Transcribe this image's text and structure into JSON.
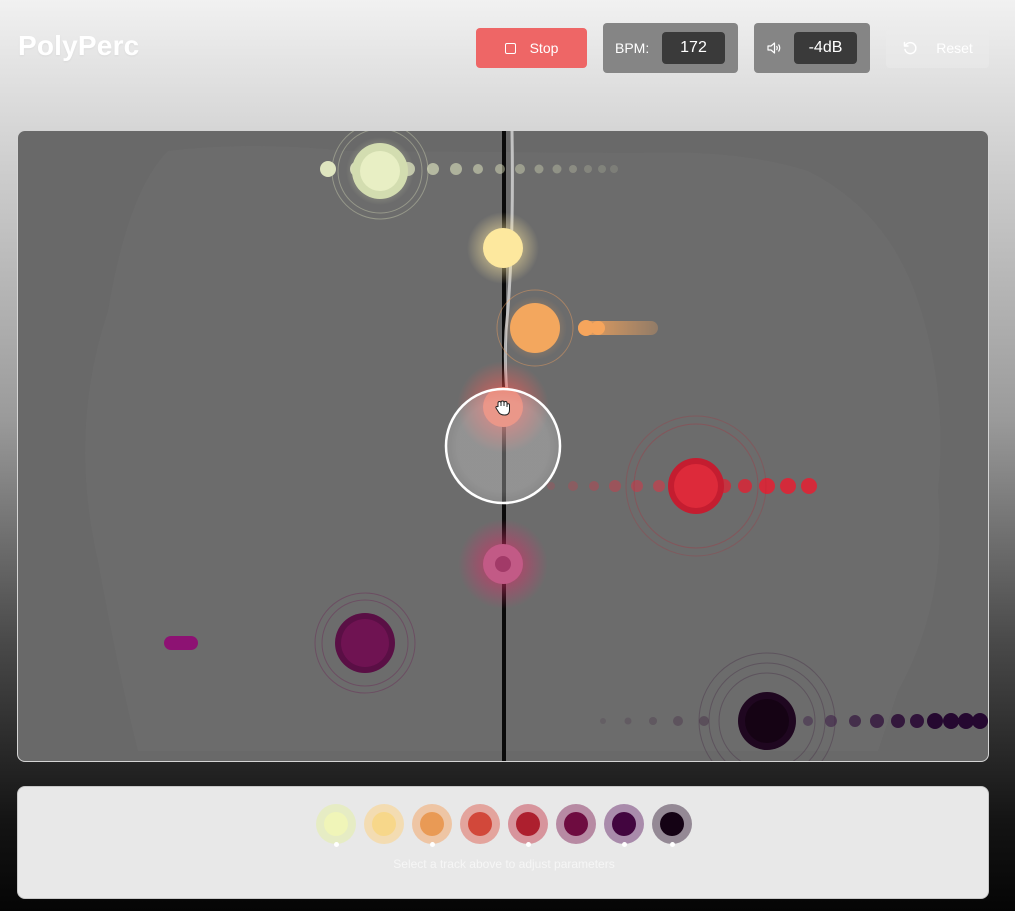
{
  "app": {
    "title": "PolyPerc"
  },
  "toolbar": {
    "stop_label": "Stop",
    "bpm_label": "BPM:",
    "bpm_value": "172",
    "volume_value": "-4dB",
    "reset_label": "Reset"
  },
  "colors": {
    "stop": "#ee6666",
    "tracks": [
      "#f0f5b8",
      "#f7d78a",
      "#e99a55",
      "#d2483a",
      "#ad1f2e",
      "#6e0c40",
      "#42053f",
      "#140214"
    ]
  },
  "tracks": {
    "hint": "Select a track above to adjust parameters",
    "items": [
      {
        "color": "#f0f5b8",
        "ring": "#e6ecc4",
        "active": true
      },
      {
        "color": "#f7d78a",
        "ring": "#f3dcb2",
        "active": false
      },
      {
        "color": "#e99a55",
        "ring": "#eec5a4",
        "active": true
      },
      {
        "color": "#d2483a",
        "ring": "#e3a49d",
        "active": false
      },
      {
        "color": "#ad1f2e",
        "ring": "#d7949c",
        "active": true
      },
      {
        "color": "#6e0c40",
        "ring": "#b78aa3",
        "active": false
      },
      {
        "color": "#42053f",
        "ring": "#a98bab",
        "active": true
      },
      {
        "color": "#140214",
        "ring": "#948995",
        "active": true
      }
    ]
  }
}
